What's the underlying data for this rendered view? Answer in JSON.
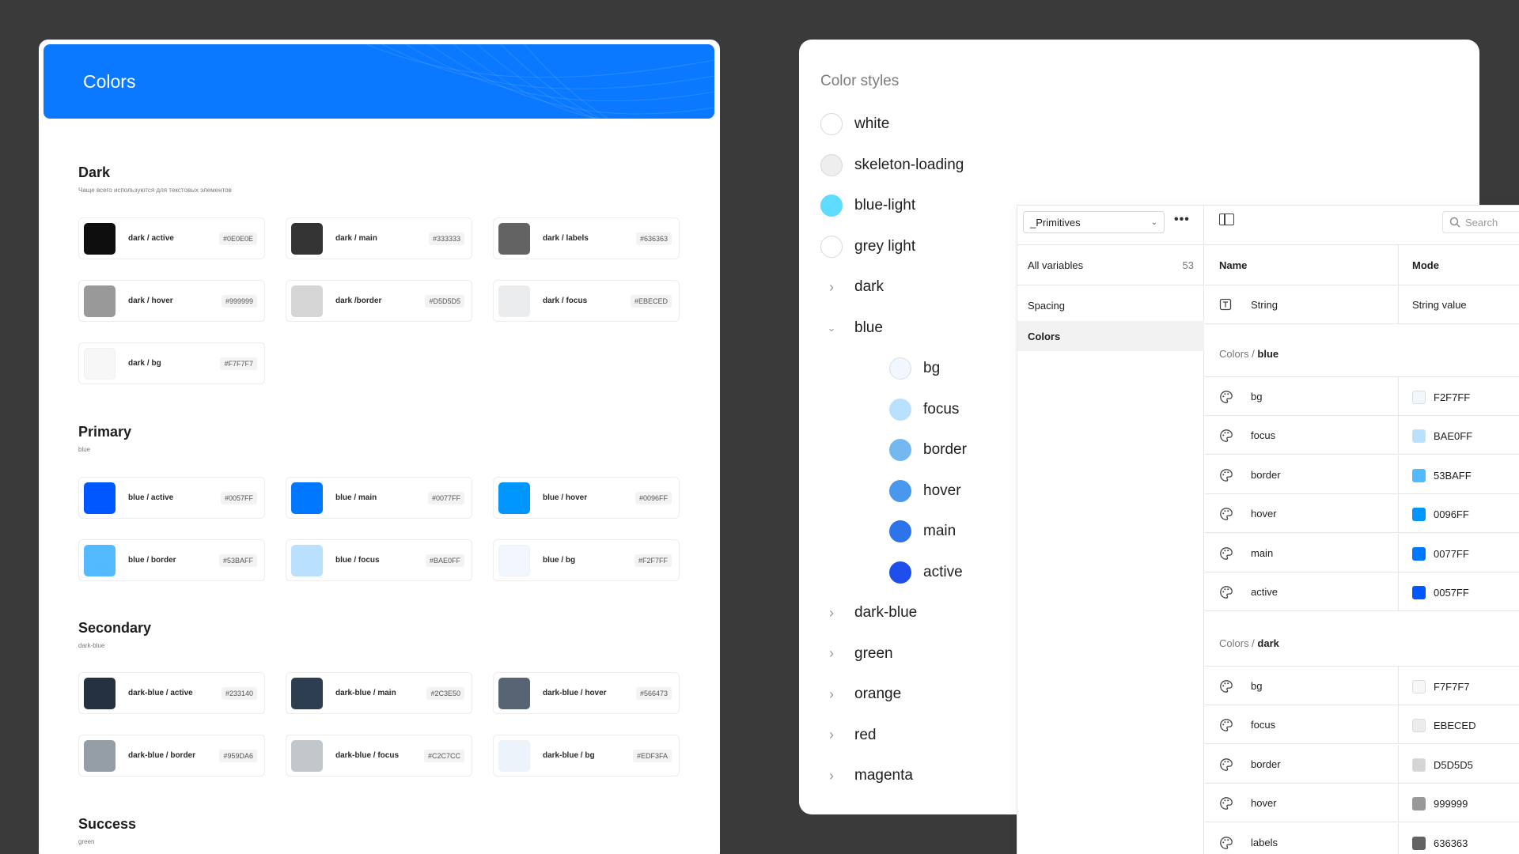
{
  "left": {
    "title": "Colors",
    "sections": [
      {
        "title": "Dark",
        "subtitle": "Чаще всего используются для текстовых элементов",
        "swatches": [
          {
            "name": "dark / active",
            "hex": "#0E0E0E",
            "color": "#0E0E0E"
          },
          {
            "name": "dark / main",
            "hex": "#333333",
            "color": "#333333"
          },
          {
            "name": "dark / labels",
            "hex": "#636363",
            "color": "#636363"
          },
          {
            "name": "dark / hover",
            "hex": "#999999",
            "color": "#999999"
          },
          {
            "name": "dark /border",
            "hex": "#D5D5D5",
            "color": "#D5D5D5"
          },
          {
            "name": "dark / focus",
            "hex": "#EBECED",
            "color": "#EBECED"
          },
          {
            "name": "dark / bg",
            "hex": "#F7F7F7",
            "color": "#F7F7F7"
          }
        ]
      },
      {
        "title": "Primary",
        "subtitle": "blue",
        "swatches": [
          {
            "name": "blue / active",
            "hex": "#0057FF",
            "color": "#0057FF"
          },
          {
            "name": "blue / main",
            "hex": "#0077FF",
            "color": "#0077FF"
          },
          {
            "name": "blue / hover",
            "hex": "#0096FF",
            "color": "#0096FF"
          },
          {
            "name": "blue / border",
            "hex": "#53BAFF",
            "color": "#53BAFF"
          },
          {
            "name": "blue / focus",
            "hex": "#BAE0FF",
            "color": "#BAE0FF"
          },
          {
            "name": "blue / bg",
            "hex": "#F2F7FF",
            "color": "#F2F7FF"
          }
        ]
      },
      {
        "title": "Secondary",
        "subtitle": "dark-blue",
        "swatches": [
          {
            "name": "dark-blue / active",
            "hex": "#233140",
            "color": "#233140"
          },
          {
            "name": "dark-blue / main",
            "hex": "#2C3E50",
            "color": "#2C3E50"
          },
          {
            "name": "dark-blue / hover",
            "hex": "#566473",
            "color": "#566473"
          },
          {
            "name": "dark-blue / border",
            "hex": "#959DA6",
            "color": "#959DA6"
          },
          {
            "name": "dark-blue / focus",
            "hex": "#C2C7CC",
            "color": "#C2C7CC"
          },
          {
            "name": "dark-blue / bg",
            "hex": "#EDF3FA",
            "color": "#EDF3FA"
          }
        ]
      },
      {
        "title": "Success",
        "subtitle": "green",
        "swatches": []
      }
    ]
  },
  "styles": {
    "title": "Color styles",
    "items": [
      {
        "label": "white",
        "color": "#FFFFFF"
      },
      {
        "label": "skeleton-loading",
        "color": "#EEEEEE"
      },
      {
        "label": "blue-light",
        "color": "#5EDCFF"
      },
      {
        "label": "grey light",
        "color": "#FFFFFF"
      }
    ],
    "groups": [
      {
        "label": "dark",
        "expanded": false
      },
      {
        "label": "blue",
        "expanded": true
      },
      {
        "label": "dark-blue",
        "expanded": false
      },
      {
        "label": "green",
        "expanded": false
      },
      {
        "label": "orange",
        "expanded": false
      },
      {
        "label": "red",
        "expanded": false
      },
      {
        "label": "magenta",
        "expanded": false
      }
    ],
    "blue_children": [
      {
        "label": "bg",
        "color": "#F2F7FF"
      },
      {
        "label": "focus",
        "color": "#BAE0FF"
      },
      {
        "label": "border",
        "color": "#74B8F2"
      },
      {
        "label": "hover",
        "color": "#4A97EE"
      },
      {
        "label": "main",
        "color": "#2D74EA"
      },
      {
        "label": "active",
        "color": "#1E4EEB"
      }
    ]
  },
  "variables": {
    "collection": "_Primitives",
    "all_label": "All variables",
    "all_count": "53",
    "groups": [
      "Spacing",
      "Colors"
    ],
    "search_placeholder": "Search",
    "col_name": "Name",
    "col_mode": "Mode",
    "string_row": {
      "name": "String",
      "value": "String value"
    },
    "color_groups": [
      {
        "prefix": "Colors /",
        "name": "blue",
        "rows": [
          {
            "name": "bg",
            "value": "F2F7FF",
            "color": "#F2F7FF"
          },
          {
            "name": "focus",
            "value": "BAE0FF",
            "color": "#BAE0FF"
          },
          {
            "name": "border",
            "value": "53BAFF",
            "color": "#53BAFF"
          },
          {
            "name": "hover",
            "value": "0096FF",
            "color": "#0096FF"
          },
          {
            "name": "main",
            "value": "0077FF",
            "color": "#0077FF"
          },
          {
            "name": "active",
            "value": "0057FF",
            "color": "#0057FF"
          }
        ]
      },
      {
        "prefix": "Colors /",
        "name": "dark",
        "rows": [
          {
            "name": "bg",
            "value": "F7F7F7",
            "color": "#F7F7F7"
          },
          {
            "name": "focus",
            "value": "EBECED",
            "color": "#EBECED"
          },
          {
            "name": "border",
            "value": "D5D5D5",
            "color": "#D5D5D5"
          },
          {
            "name": "hover",
            "value": "999999",
            "color": "#999999"
          },
          {
            "name": "labels",
            "value": "636363",
            "color": "#636363"
          }
        ]
      }
    ]
  }
}
